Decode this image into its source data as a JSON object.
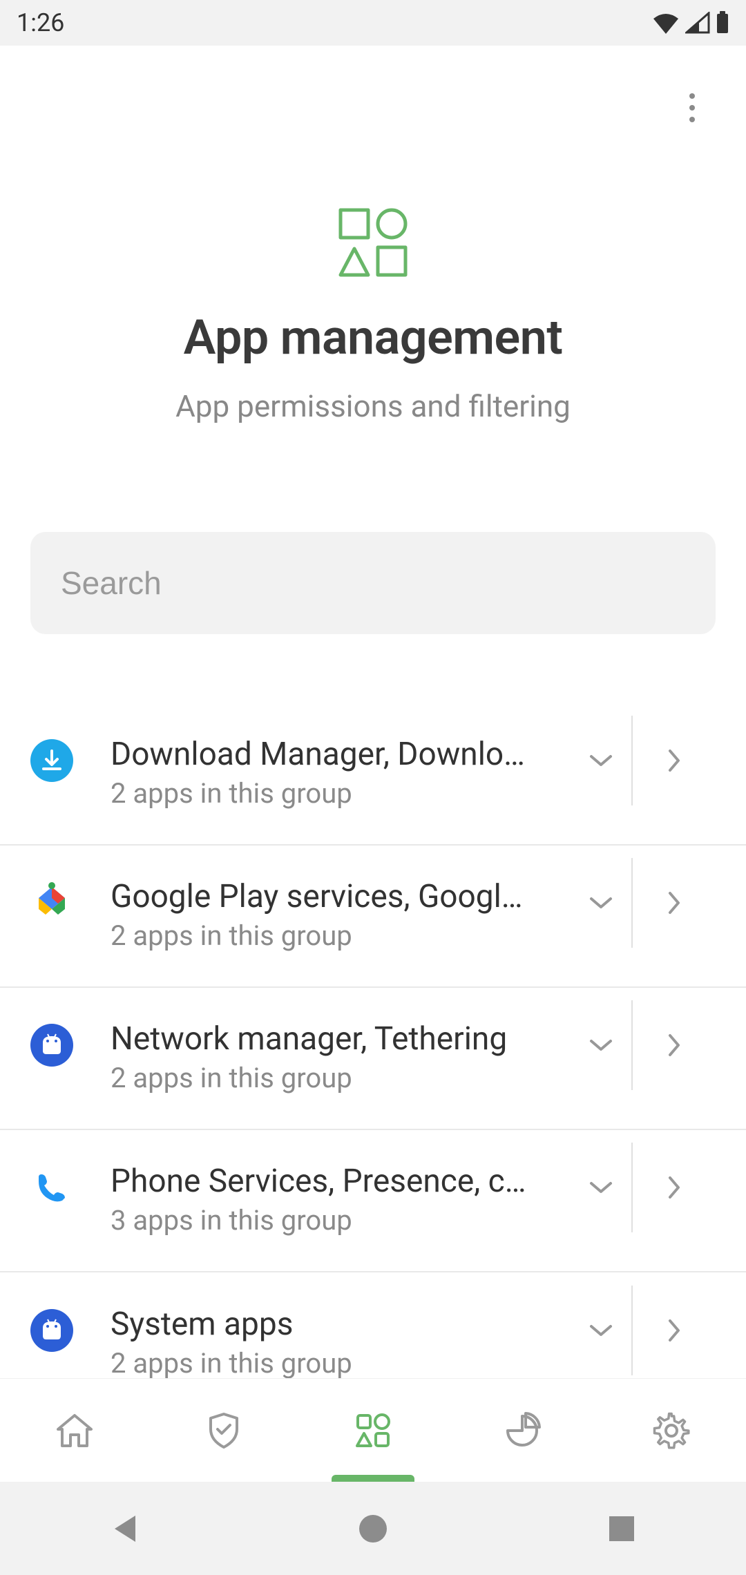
{
  "status": {
    "time": "1:26"
  },
  "header": {
    "title": "App management",
    "subtitle": "App permissions and filtering"
  },
  "search": {
    "placeholder": "Search"
  },
  "apps": [
    {
      "title": "Download Manager, Downlo…",
      "subtitle": "2 apps in this group",
      "icon": "download"
    },
    {
      "title": "Google Play services, Googl…",
      "subtitle": "2 apps in this group",
      "icon": "play"
    },
    {
      "title": "Network manager, Tethering",
      "subtitle": "2 apps in this group",
      "icon": "android"
    },
    {
      "title": "Phone Services, Presence, c…",
      "subtitle": "3 apps in this group",
      "icon": "phone"
    },
    {
      "title": "System apps",
      "subtitle": "2 apps in this group",
      "icon": "android"
    }
  ],
  "tabs": [
    {
      "name": "home",
      "active": false
    },
    {
      "name": "protection",
      "active": false
    },
    {
      "name": "apps",
      "active": true
    },
    {
      "name": "stats",
      "active": false
    },
    {
      "name": "settings",
      "active": false
    }
  ],
  "colors": {
    "accent": "#68b668",
    "text_primary": "#333",
    "text_secondary": "#888"
  }
}
